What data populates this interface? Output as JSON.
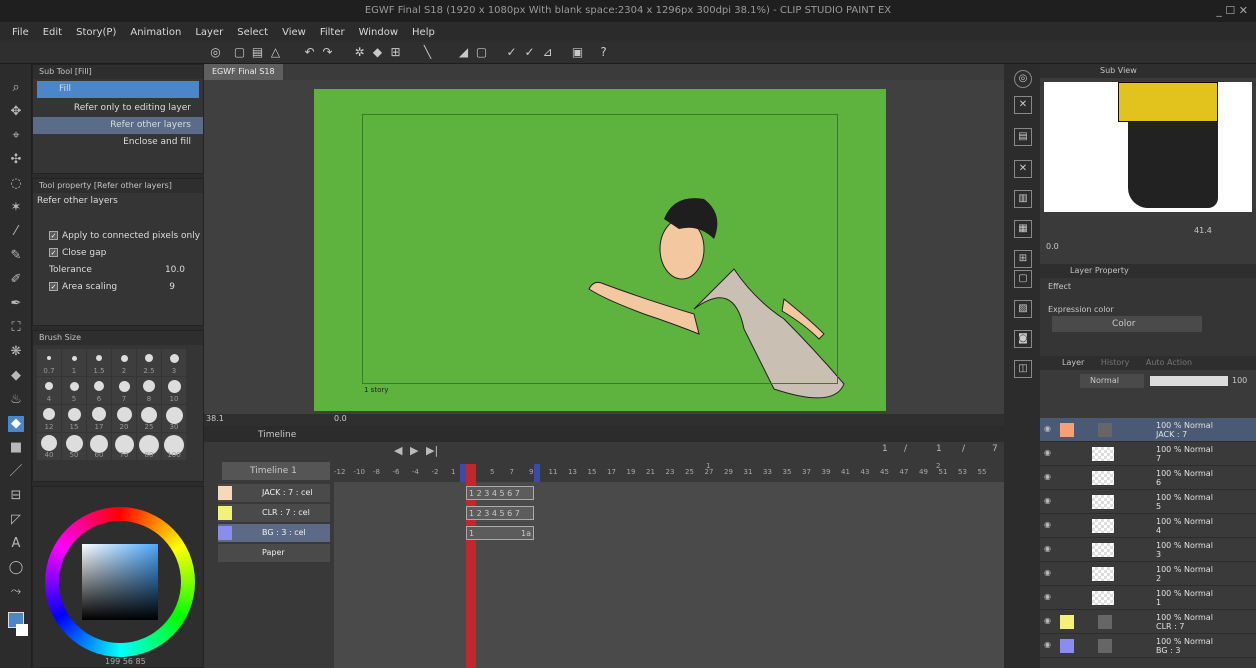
{
  "window": {
    "title": "EGWF Final S18 (1920 x 1080px With blank space:2304 x 1296px 300dpi 38.1%)  - CLIP STUDIO PAINT EX",
    "controls": "_ ☐ ✕"
  },
  "menu": [
    "File",
    "Edit",
    "Story(P)",
    "Animation",
    "Layer",
    "Select",
    "View",
    "Filter",
    "Window",
    "Help"
  ],
  "subtool": {
    "header": "Sub Tool [Fill]",
    "group": "Fill",
    "items": [
      "Refer only to editing layer",
      "Refer other layers",
      "Enclose and fill"
    ]
  },
  "toolprop": {
    "header": "Tool property [Refer other layers]",
    "name": "Refer other layers",
    "apply_connected": "Apply to connected pixels only",
    "close_gap": "Close gap",
    "tolerance_label": "Tolerance",
    "tolerance_value": "10.0",
    "area_scaling_label": "Area scaling",
    "area_scaling_value": "9"
  },
  "brushsize": {
    "header": "Brush Size",
    "sizes": [
      "0.7",
      "1",
      "1.5",
      "2",
      "2.5",
      "3",
      "4",
      "5",
      "6",
      "7",
      "8",
      "10",
      "12",
      "15",
      "17",
      "20",
      "25",
      "30",
      "40",
      "50",
      "60",
      "70",
      "80",
      "100"
    ]
  },
  "colorpanel": {
    "readout": "199  56  85"
  },
  "canvas": {
    "tab": "EGWF Final S18",
    "zoom": "38.1",
    "rotation": "0.0",
    "frame_label": "1 story"
  },
  "timeline": {
    "header": "Timeline",
    "name": "Timeline 1",
    "ruler": [
      "-12",
      "-10",
      "-8",
      "-6",
      "-4",
      "-2",
      "1",
      "3",
      "5",
      "7",
      "9",
      "11",
      "13",
      "15",
      "17",
      "19",
      "21",
      "23",
      "25",
      "27",
      "29",
      "31",
      "33",
      "35",
      "37",
      "39",
      "41",
      "43",
      "45",
      "47",
      "49",
      "51",
      "53",
      "55"
    ],
    "counter_left": "1",
    "counter_sep1": "/",
    "counter_mid": "1",
    "counter_sep2": "/",
    "counter_right": "7",
    "marker_1": "1",
    "marker_2": "2",
    "tracks": [
      {
        "label": "JACK : 7 : cel",
        "color": "#f6d9b8",
        "cells": "1 2 3 4 5 6 7"
      },
      {
        "label": "CLR : 7 : cel",
        "color": "#f4f17a",
        "cells": "1 2 3 4 5 6 7"
      },
      {
        "label": "BG : 3 : cel",
        "color": "#8b8cf0",
        "cells_start": "1",
        "cells_end": "1a"
      },
      {
        "label": "Paper",
        "color": "#cfcfcf",
        "cells": ""
      }
    ]
  },
  "subview": {
    "header": "Sub View",
    "zoom": "41.4",
    "rotation": "0.0"
  },
  "layerprop": {
    "header": "Layer Property",
    "effect": "Effect",
    "expression_color": "Expression color",
    "color_mode": "Color"
  },
  "layerpanel": {
    "tabs": [
      "Layer",
      "History",
      "Auto Action"
    ],
    "blend": "Normal",
    "opacity": "100",
    "layers": [
      {
        "opacity": "100 %",
        "mode": "Normal",
        "name": "JACK : 7",
        "kind": "folder",
        "color": "#f6a07a"
      },
      {
        "opacity": "100 %",
        "mode": "Normal",
        "name": "7",
        "kind": "cel"
      },
      {
        "opacity": "100 %",
        "mode": "Normal",
        "name": "6",
        "kind": "cel"
      },
      {
        "opacity": "100 %",
        "mode": "Normal",
        "name": "5",
        "kind": "cel"
      },
      {
        "opacity": "100 %",
        "mode": "Normal",
        "name": "4",
        "kind": "raster"
      },
      {
        "opacity": "100 %",
        "mode": "Normal",
        "name": "3",
        "kind": "raster"
      },
      {
        "opacity": "100 %",
        "mode": "Normal",
        "name": "2",
        "kind": "raster"
      },
      {
        "opacity": "100 %",
        "mode": "Normal",
        "name": "1",
        "kind": "raster"
      },
      {
        "opacity": "100 %",
        "mode": "Normal",
        "name": "CLR : 7",
        "kind": "folder",
        "color": "#f4f17a"
      },
      {
        "opacity": "100 %",
        "mode": "Normal",
        "name": "BG : 3",
        "kind": "folder",
        "color": "#8b8cf0"
      }
    ]
  },
  "colors": {
    "accent": "#4a86c8",
    "canvas": "#5db33e",
    "playhead": "#c0282d"
  }
}
